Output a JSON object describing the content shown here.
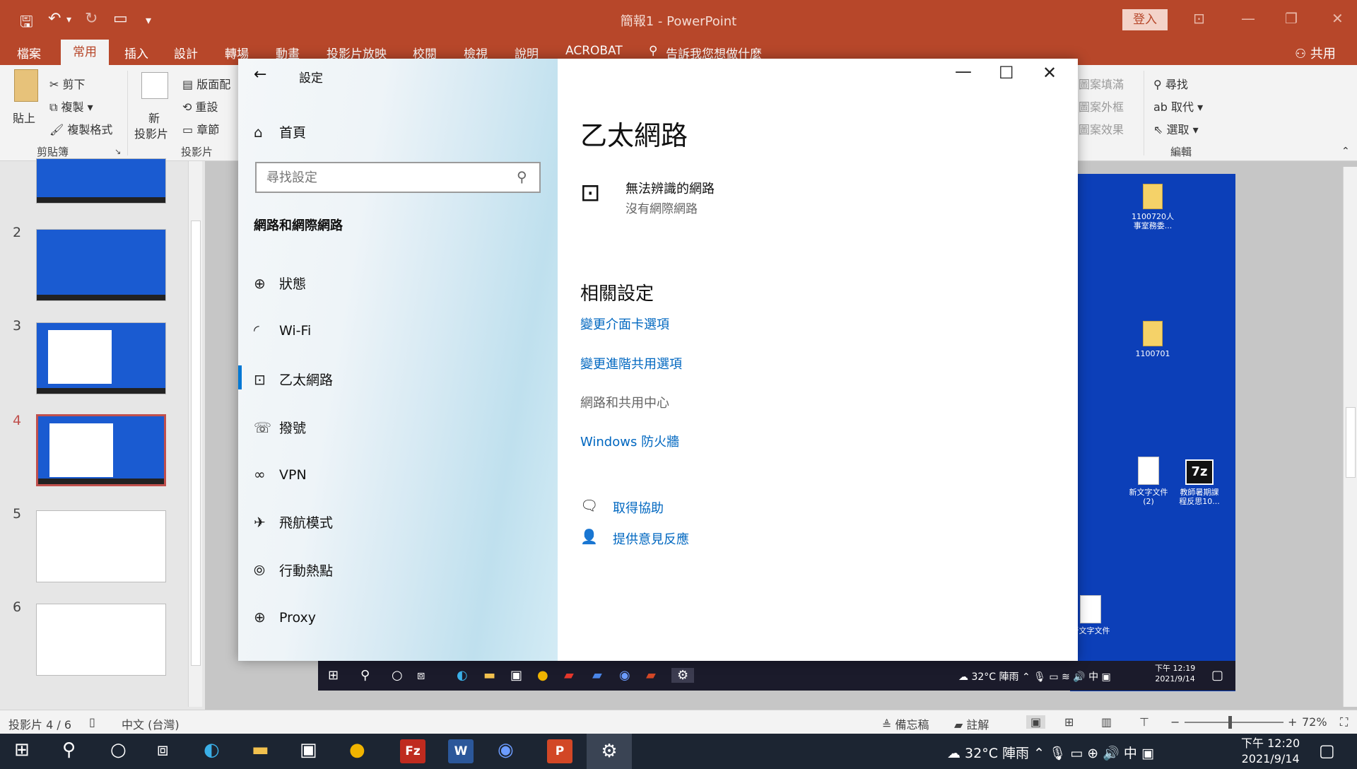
{
  "ppt": {
    "doc_title": "簡報1 - PowerPoint",
    "login": "登入",
    "share": "共用",
    "tabs": [
      "檔案",
      "常用",
      "插入",
      "設計",
      "轉場",
      "動畫",
      "投影片放映",
      "校閱",
      "檢視",
      "說明",
      "ACROBAT"
    ],
    "tell_me": "告訴我您想做什麼",
    "ribbon": {
      "paste": "貼上",
      "cut": "剪下",
      "copy": "複製",
      "format_painter": "複製格式",
      "new_slide_1": "新",
      "new_slide_2": "投影片",
      "layout": "版面配",
      "reset": "重設",
      "section": "章節",
      "shape_fill": "圖案填滿",
      "shape_outline": "圖案外框",
      "shape_effects": "圖案效果",
      "find": "尋找",
      "replace": "取代",
      "select": "選取",
      "group_clipboard": "剪貼簿",
      "group_slides": "投影片",
      "group_editing": "編輯"
    },
    "slide_numbers": [
      "2",
      "3",
      "4",
      "5",
      "6"
    ],
    "status": {
      "slide_count": "投影片 4 / 6",
      "language": "中文 (台灣)",
      "notes": "備忘稿",
      "comments": "註解",
      "zoom": "72%"
    }
  },
  "settings": {
    "title": "設定",
    "home": "首頁",
    "search_placeholder": "尋找設定",
    "section": "網路和網際網路",
    "nav": [
      {
        "label": "狀態",
        "icon": "globe-status-icon"
      },
      {
        "label": "Wi-Fi",
        "icon": "wifi-icon"
      },
      {
        "label": "乙太網路",
        "icon": "ethernet-icon"
      },
      {
        "label": "撥號",
        "icon": "dialup-icon"
      },
      {
        "label": "VPN",
        "icon": "vpn-icon"
      },
      {
        "label": "飛航模式",
        "icon": "airplane-icon"
      },
      {
        "label": "行動熱點",
        "icon": "hotspot-icon"
      },
      {
        "label": "Proxy",
        "icon": "globe-icon"
      }
    ],
    "page_title": "乙太網路",
    "network_name": "無法辨識的網路",
    "network_status": "沒有網際網路",
    "related_title": "相關設定",
    "related_links": [
      "變更介面卡選項",
      "變更進階共用選項",
      "網路和共用中心",
      "Windows 防火牆"
    ],
    "help": "取得協助",
    "feedback": "提供意見反應",
    "accent_color": "#0078d4"
  },
  "slide_desktop": {
    "icons": [
      {
        "label": "1100720人事室務委..."
      },
      {
        "label": "1100701"
      },
      {
        "label": "新文字文件 (2)"
      },
      {
        "label": "教師暑期課程反思10..."
      },
      {
        "label": "新文字文件"
      }
    ],
    "sevenz": "7z",
    "weather": "32°C 陣雨",
    "tray_ime": "中",
    "time": "下午 12:19",
    "date": "2021/9/14"
  },
  "taskbar": {
    "weather": "32°C 陣雨",
    "ime": "中",
    "time": "下午 12:20",
    "date": "2021/9/14"
  },
  "colors": {
    "ppt_red": "#b7472a",
    "taskbar": "#1c2532",
    "link": "#0067c0"
  }
}
